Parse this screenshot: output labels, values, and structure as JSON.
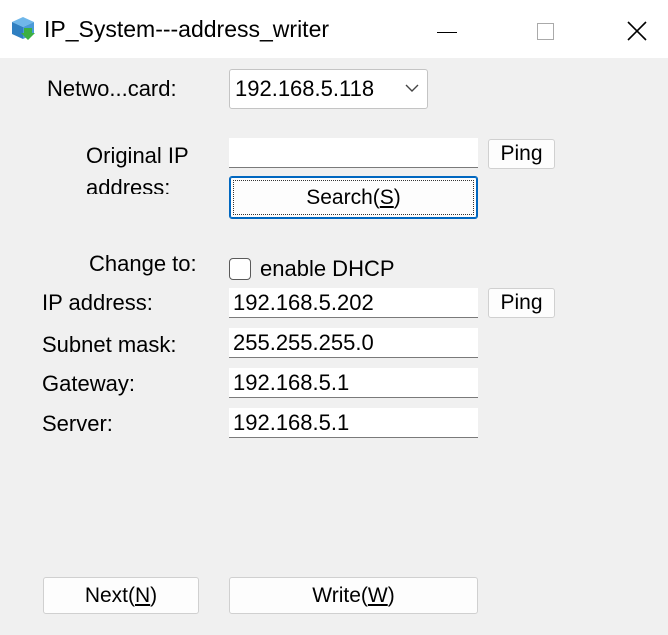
{
  "window": {
    "title": "IP_System---address_writer"
  },
  "network_card": {
    "label": "Netwo...card:",
    "selected": "192.168.5.118"
  },
  "original_ip": {
    "label_line1": "Original IP",
    "label_line2": "address:",
    "value": "",
    "ping_label": "Ping",
    "search_label_prefix": "Search(",
    "search_label_key": "S",
    "search_label_suffix": ")"
  },
  "change_to": {
    "label": "Change to:",
    "dhcp_label": "enable DHCP",
    "dhcp_checked": false
  },
  "fields": {
    "ip_label": "IP address:",
    "ip_value": "192.168.5.202",
    "ip_ping_label": "Ping",
    "subnet_label": "Subnet mask:",
    "subnet_value": "255.255.255.0",
    "gateway_label": "Gateway:",
    "gateway_value": "192.168.5.1",
    "server_label": "Server:",
    "server_value": "192.168.5.1"
  },
  "actions": {
    "next_prefix": "Next(",
    "next_key": "N",
    "next_suffix": ")",
    "write_prefix": "Write(",
    "write_key": "W",
    "write_suffix": ")"
  },
  "icons": {
    "app": "app-icon",
    "minimize": "minimize-icon",
    "maximize": "maximize-icon",
    "close": "close-icon",
    "dropdown": "chevron-down-icon"
  },
  "colors": {
    "window_bg": "#f0f0f0",
    "titlebar_bg": "#ffffff",
    "focus_border": "#0067c0"
  }
}
